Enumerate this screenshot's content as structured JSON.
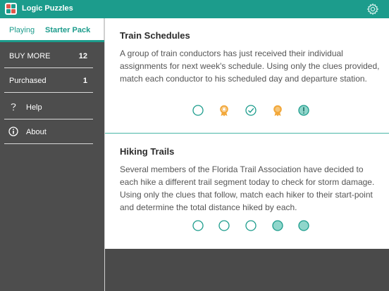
{
  "app": {
    "title": "Logic Puzzles"
  },
  "sidebar": {
    "tabs": [
      {
        "label": "Playing"
      },
      {
        "label": "Starter Pack",
        "active": true
      }
    ],
    "rows": [
      {
        "label": "BUY MORE",
        "count": "12"
      },
      {
        "label": "Purchased",
        "count": "1"
      },
      {
        "label": "Help",
        "icon": "question-icon"
      },
      {
        "label": "About",
        "icon": "info-icon"
      }
    ]
  },
  "puzzles": [
    {
      "title": "Train Schedules",
      "description": "A group of train conductors has just received their individual assignments for next week's schedule.  Using only the clues provided, match each conductor to his scheduled day and departure station.",
      "status_icons": [
        "empty-circle-icon",
        "ribbon-icon",
        "check-circle-icon",
        "ribbon-filled-icon",
        "exclamation-circle-icon"
      ]
    },
    {
      "title": "Hiking Trails",
      "description": "Several members of the Florida Trail Association have decided to each hike a different trail segment today to check for storm damage.  Using only the clues that follow, match each hiker to their start-point and determine the total distance hiked by each.",
      "status_icons": [
        "empty-circle-icon",
        "empty-circle-icon",
        "empty-circle-icon",
        "filled-circle-icon",
        "filled-circle-icon"
      ]
    }
  ],
  "colors": {
    "accent": "#1c9c8c",
    "ribbon": "#f2a83b",
    "sidebar": "#4d4d4d"
  }
}
